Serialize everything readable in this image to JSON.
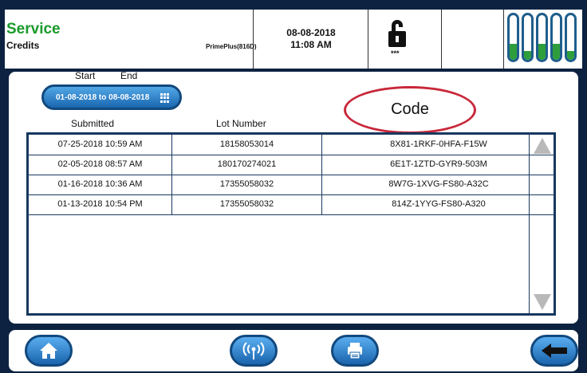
{
  "header": {
    "title": "Service",
    "subtitle": "Credits",
    "model": "PrimePlus(816D)",
    "date": "08-08-2018",
    "time": "11:08 AM",
    "lock_stars": "***",
    "gauge_levels": [
      0.35,
      0.2,
      0.35,
      0.35,
      0.2
    ]
  },
  "filters": {
    "start_label": "Start",
    "end_label": "End",
    "range_button": "01-08-2018 to 08-08-2018"
  },
  "columns": {
    "submitted": "Submitted",
    "lot_number": "Lot Number",
    "code": "Code"
  },
  "rows": [
    {
      "submitted": "07-25-2018 10:59 AM",
      "lot": "18158053014",
      "code": "8X81-1RKF-0HFA-F15W"
    },
    {
      "submitted": "02-05-2018 08:57 AM",
      "lot": "180170274021",
      "code": "6E1T-1ZTD-GYR9-503M"
    },
    {
      "submitted": "01-16-2018 10:36 AM",
      "lot": "17355058032",
      "code": "8W7G-1XVG-FS80-A32C"
    },
    {
      "submitted": "01-13-2018 10:54 PM",
      "lot": "17355058032",
      "code": "814Z-1YYG-FS80-A320"
    }
  ],
  "colors": {
    "title_green": "#1a9a2a",
    "button_blue": "#1a66b0",
    "highlight_red": "#c8283a",
    "gauge_green": "#2e9e3c"
  }
}
